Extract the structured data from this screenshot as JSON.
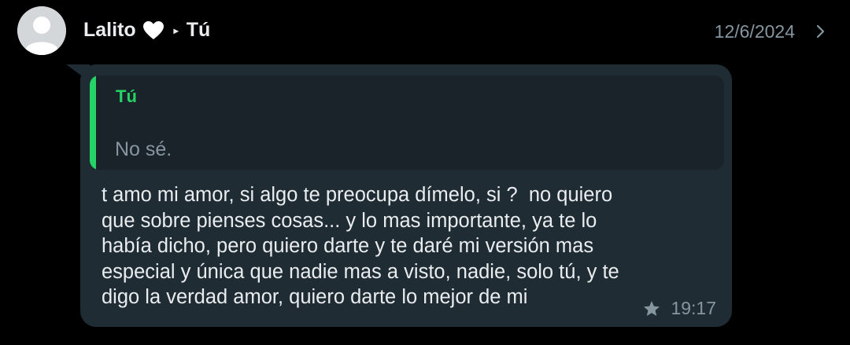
{
  "header": {
    "sender_name": "Lalito",
    "heart_emoji": "white-heart-icon",
    "recipient": "Tú",
    "date": "12/6/2024"
  },
  "message": {
    "quote": {
      "author": "Tú",
      "text": "No sé."
    },
    "text": "t amo mi amor, si algo te preocupa dímelo, si ?  no quiero\nque sobre pienses cosas... y lo mas importante, ya te lo\nhabía dicho, pero quiero darte y te daré mi versión mas\nespecial y única que nadie mas a visto, nadie, solo tú, y te\ndigo la verdad amor, quiero darte lo mejor de mi",
    "time": "19:17",
    "starred": true
  },
  "colors": {
    "background": "#000000",
    "bubble": "#202c33",
    "quote_bg": "#1a2329",
    "accent_green": "#25d366",
    "muted": "#8696a0",
    "text": "#e9edef"
  }
}
